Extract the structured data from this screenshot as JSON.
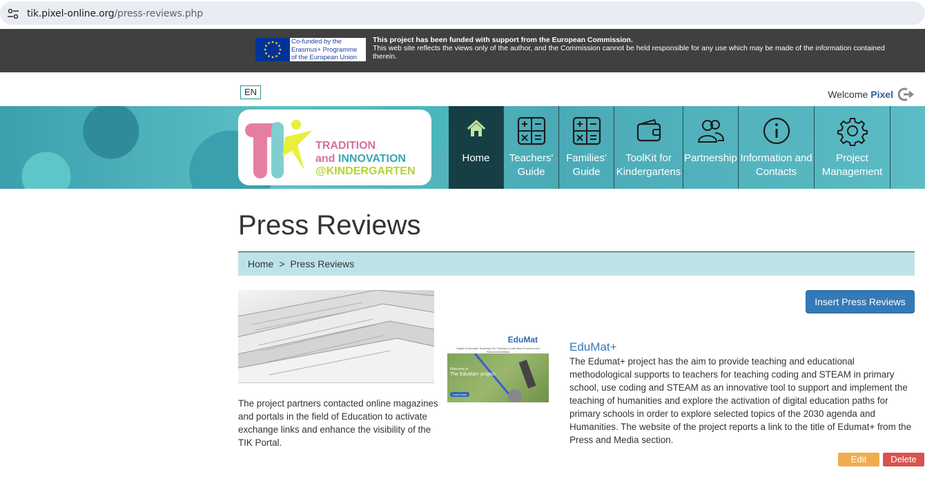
{
  "browser": {
    "url_host": "tik.pixel-online.org",
    "url_path": "/press-reviews.php"
  },
  "eu_banner": {
    "logo_lines": [
      "Co-funded by the",
      "Erasmus+ Programme",
      "of the European Union"
    ],
    "headline": "This project has been funded with support from the European Commission.",
    "disclaimer": "This web site reflects the views only of the author, and the Commission cannot be held responsible for any use which may be made of the information contained therein."
  },
  "topbar": {
    "language": "EN",
    "welcome": "Welcome",
    "user": "Pixel"
  },
  "logo": {
    "line1": "TRADITION",
    "line2a": "and",
    "line2b": "INNOVATION",
    "line3": "@KINDERGARTEN"
  },
  "nav": {
    "items": [
      {
        "label": "Home",
        "icon": "home-icon"
      },
      {
        "label": "Teachers' Guide",
        "icon": "calculator-icon"
      },
      {
        "label": "Families' Guide",
        "icon": "calculator-icon"
      },
      {
        "label": "ToolKit for Kindergartens",
        "icon": "wallet-icon"
      },
      {
        "label": "Partnership",
        "icon": "users-icon"
      },
      {
        "label": "Information and Contacts",
        "icon": "info-icon"
      },
      {
        "label": "Project Management",
        "icon": "gear-icon"
      }
    ]
  },
  "page": {
    "title": "Press Reviews",
    "breadcrumb": [
      "Home",
      "Press Reviews"
    ],
    "intro": "The project partners contacted online magazines and portals in the field of Education to activate exchange links and enhance the visibility of the TIK Portal.",
    "insert_button": "Insert Press Reviews"
  },
  "review": {
    "thumb_logo": "EduMat",
    "thumb_menu": "Digital & Nomadic Teaching Kits    Training Course    Best Practices and Recommendations",
    "thumb_welcome": "Welcome to",
    "thumb_headline": "The EduMat+ project",
    "thumb_button": "Learn More",
    "title": "EduMat+",
    "description": "The Edumat+ project has the aim to provide teaching and educational methodological supports to teachers for teaching coding and STEAM in primary school, use coding and STEAM as an innovative tool to support and implement the teaching of humanities and explore the activation of digital education paths for primary schools in order to explore selected topics of the 2030 agenda and Humanities. The website of the project reports a link to the title of Edumat+ from the Press and Media section.",
    "edit_label": "Edit",
    "delete_label": "Delete"
  }
}
